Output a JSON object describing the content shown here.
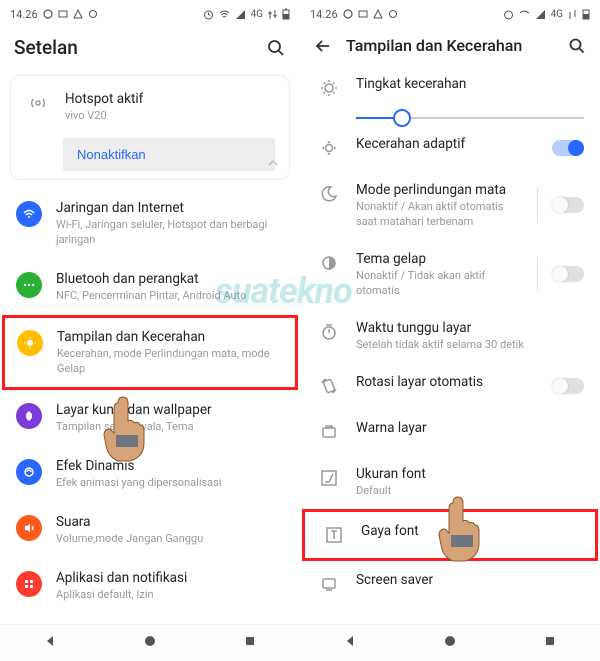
{
  "status": {
    "time": "14.26",
    "network": "4G"
  },
  "left": {
    "title": "Setelan",
    "hotspot": {
      "title": "Hotspot aktif",
      "sub": "vivo V20",
      "button": "Nonaktifkan"
    },
    "items": [
      {
        "title": "Jaringan dan Internet",
        "sub": "Wi-Fi, Jaringan seluler, Hotspot dan berbagi jaringan"
      },
      {
        "title": "Bluetooh dan perangkat",
        "sub": "NFC, Pencerminan Pintar, Android Auto"
      },
      {
        "title": "Tampilan dan Kecerahan",
        "sub": "Kecerahan, mode Perlindungan mata, mode Gelap"
      },
      {
        "title": "Layar kunci dan wallpaper",
        "sub": "Tampilan selalu nyala, Tema"
      },
      {
        "title": "Efek Dinamis",
        "sub": "Efek animasi yang dipersonalisasi"
      },
      {
        "title": "Suara",
        "sub": "Volume,mode Jangan Ganggu"
      },
      {
        "title": "Aplikasi dan notifikasi",
        "sub": "Aplikasi default, Izin"
      }
    ]
  },
  "right": {
    "title": "Tampilan dan Kecerahan",
    "items": [
      {
        "title": "Tingkat kecerahan"
      },
      {
        "title": "Kecerahan adaptif"
      },
      {
        "title": "Mode perlindungan mata",
        "sub": "Nonaktif / Akan aktif otomatis saat matahari terbenam"
      },
      {
        "title": "Tema gelap",
        "sub": "Nonaktif / Tidak akan aktif otomatis"
      },
      {
        "title": "Waktu tunggu layar",
        "sub": "Setelah tidak aktif selama 30 detik"
      },
      {
        "title": "Rotasi layar otomatis"
      },
      {
        "title": "Warna layar"
      },
      {
        "title": "Ukuran font",
        "sub": "Default"
      },
      {
        "title": "Gaya font"
      },
      {
        "title": "Screen saver"
      }
    ]
  }
}
